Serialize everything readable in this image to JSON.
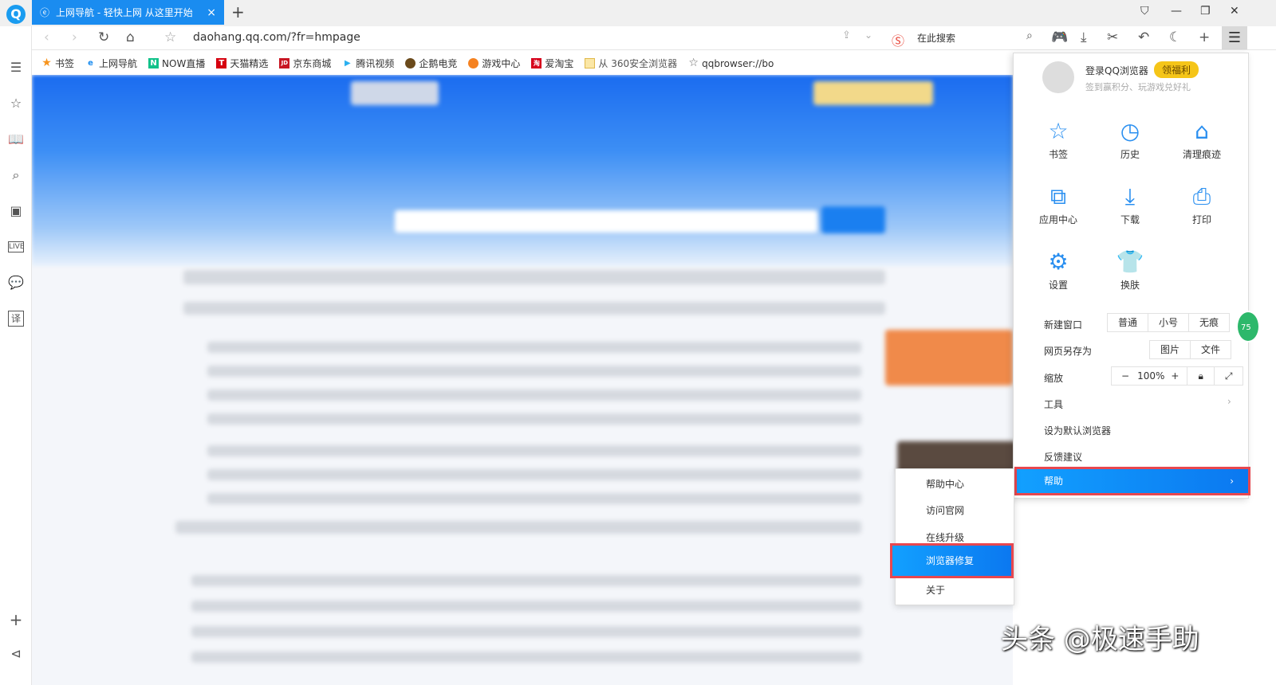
{
  "tab": {
    "title": "上网导航 - 轻快上网 从这里开始",
    "close": "×",
    "new_tab": "+"
  },
  "toolbar": {
    "url": "daohang.qq.com/?fr=hmpage",
    "search_placeholder": "在此搜索"
  },
  "bookmarks": [
    {
      "label": "书签",
      "color": "#f7941d",
      "icon": "★"
    },
    {
      "label": "上网导航",
      "color": "#1a8cf0",
      "icon": "e"
    },
    {
      "label": "NOW直播",
      "color": "#12c28a",
      "icon": "N"
    },
    {
      "label": "天猫精选",
      "color": "#d6000f",
      "icon": "T"
    },
    {
      "label": "京东商城",
      "color": "#c81623",
      "icon": "JD"
    },
    {
      "label": "腾讯视频",
      "color": "#2ab0f0",
      "icon": "▶"
    },
    {
      "label": "企鹅电竞",
      "color": "#6b4a1c",
      "icon": "●"
    },
    {
      "label": "游戏中心",
      "color": "#f58220",
      "icon": "●"
    },
    {
      "label": "爱淘宝",
      "color": "#d6001c",
      "icon": "淘"
    },
    {
      "label": "从 360安全浏览器",
      "color": "#f0c64a",
      "icon": "▭"
    },
    {
      "label": "qqbrowser://bo",
      "color": "#666",
      "icon": "☆"
    }
  ],
  "menu": {
    "login": "登录QQ浏览器",
    "welfare": "领福利",
    "subtitle": "签到赢积分、玩游戏兑好礼",
    "grid": [
      {
        "label": "书签",
        "icon": "☆"
      },
      {
        "label": "历史",
        "icon": "◷"
      },
      {
        "label": "清理痕迹",
        "icon": "⌂"
      },
      {
        "label": "应用中心",
        "icon": "⧉"
      },
      {
        "label": "下载",
        "icon": "⤓"
      },
      {
        "label": "打印",
        "icon": "⎙"
      },
      {
        "label": "设置",
        "icon": "⚙"
      },
      {
        "label": "换肤",
        "icon": "👕"
      }
    ],
    "new_window": "新建窗口",
    "nw_opts": [
      "普通",
      "小号",
      "无痕"
    ],
    "save_as": "网页另存为",
    "save_opts": [
      "图片",
      "文件"
    ],
    "zoom": "缩放",
    "zoom_minus": "−",
    "zoom_value": "100%",
    "zoom_plus": "+",
    "tools": "工具",
    "set_default": "设为默认浏览器",
    "feedback": "反馈建议",
    "help": "帮助",
    "arrow": "›"
  },
  "submenu": {
    "items": [
      "帮助中心",
      "访问官网",
      "在线升级",
      "浏览器修复",
      "关于"
    ]
  },
  "badge": "75",
  "watermark": "头条 @极速手助"
}
